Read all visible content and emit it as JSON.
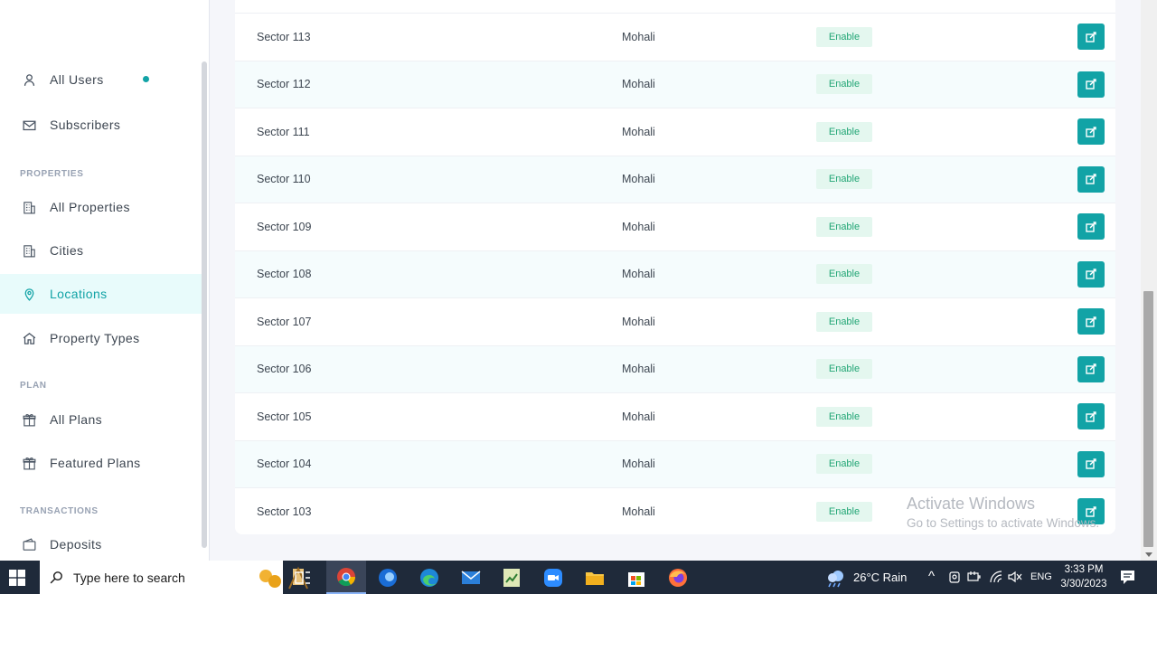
{
  "sidebar": {
    "items": [
      {
        "label": "All Users",
        "icon": "user-icon"
      },
      {
        "label": "Subscribers",
        "icon": "envelope-icon"
      },
      {
        "label": "All Properties",
        "icon": "building-icon"
      },
      {
        "label": "Cities",
        "icon": "building-icon"
      },
      {
        "label": "Locations",
        "icon": "map-pin-icon",
        "active": true
      },
      {
        "label": "Property Types",
        "icon": "home-icon"
      },
      {
        "label": "All Plans",
        "icon": "gift-icon"
      },
      {
        "label": "Featured Plans",
        "icon": "gift-icon"
      },
      {
        "label": "Deposits",
        "icon": "wallet-icon"
      }
    ],
    "sections": {
      "properties": "PROPERTIES",
      "plan": "PLAN",
      "transactions": "TRANSACTIONS"
    }
  },
  "table": {
    "status_label": "Enable",
    "rows": [
      {
        "name": "Sector 113",
        "city": "Mohali",
        "status": "Enable"
      },
      {
        "name": "Sector 112",
        "city": "Mohali",
        "status": "Enable"
      },
      {
        "name": "Sector 111",
        "city": "Mohali",
        "status": "Enable"
      },
      {
        "name": "Sector 110",
        "city": "Mohali",
        "status": "Enable"
      },
      {
        "name": "Sector 109",
        "city": "Mohali",
        "status": "Enable"
      },
      {
        "name": "Sector 108",
        "city": "Mohali",
        "status": "Enable"
      },
      {
        "name": "Sector 107",
        "city": "Mohali",
        "status": "Enable"
      },
      {
        "name": "Sector 106",
        "city": "Mohali",
        "status": "Enable"
      },
      {
        "name": "Sector 105",
        "city": "Mohali",
        "status": "Enable"
      },
      {
        "name": "Sector 104",
        "city": "Mohali",
        "status": "Enable"
      },
      {
        "name": "Sector 103",
        "city": "Mohali",
        "status": "Enable"
      }
    ]
  },
  "watermark": {
    "line1": "Activate Windows",
    "line2": "Go to Settings to activate Windows."
  },
  "taskbar": {
    "search_placeholder": "Type here to search",
    "weather": "26°C  Rain",
    "language": "ENG",
    "time": "3:33 PM",
    "date": "3/30/2023"
  },
  "colors": {
    "accent": "#12a3a6",
    "badge_bg": "#e4f7ef",
    "badge_text": "#22a675",
    "active_nav_bg": "#e8fbfb",
    "taskbar": "#1f2a3a"
  }
}
